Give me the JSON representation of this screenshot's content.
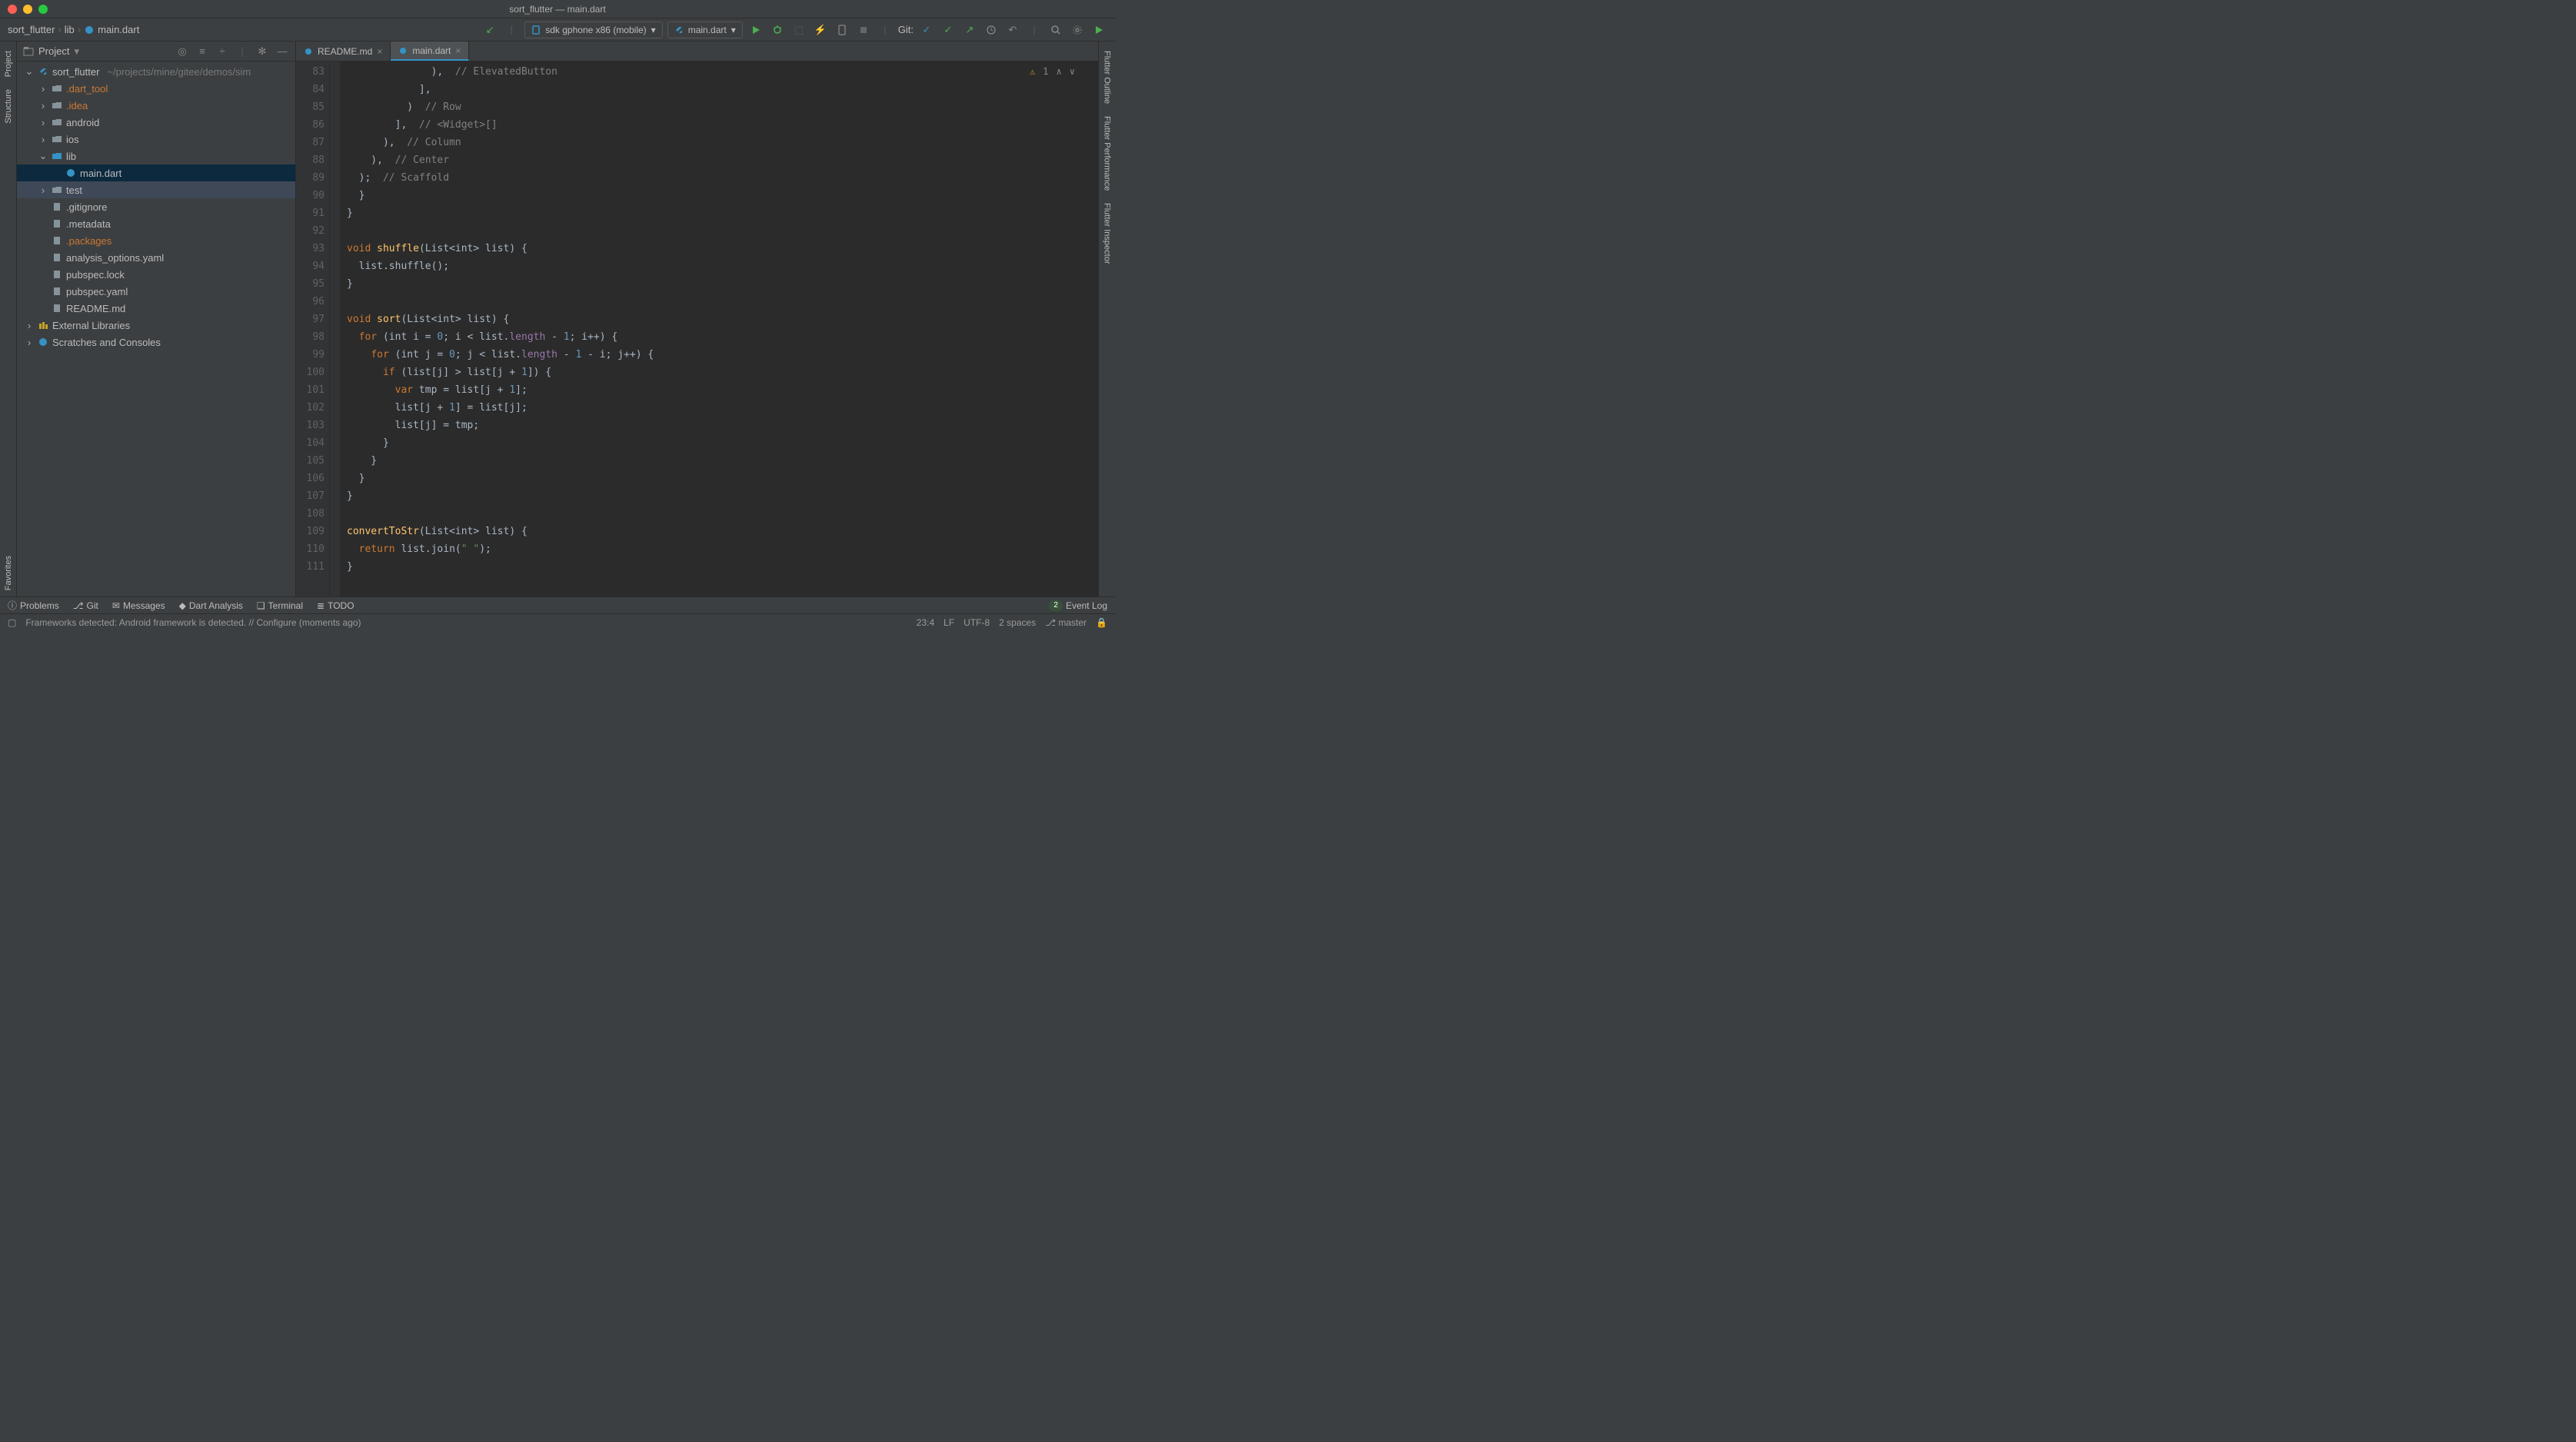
{
  "title": "sort_flutter — main.dart",
  "breadcrumb": [
    "sort_flutter",
    "lib",
    "main.dart"
  ],
  "toolbar": {
    "device": "sdk gphone x86 (mobile)",
    "config": "main.dart",
    "git_label": "Git:"
  },
  "project_panel": {
    "title": "Project"
  },
  "tree": {
    "root": {
      "name": "sort_flutter",
      "path": "~/projects/mine/gitee/demos/sim"
    },
    "items": [
      {
        "label": ".dart_tool",
        "orange": true,
        "arrow": ">",
        "indent": 1
      },
      {
        "label": ".idea",
        "orange": true,
        "arrow": ">",
        "indent": 1
      },
      {
        "label": "android",
        "arrow": ">",
        "indent": 1
      },
      {
        "label": "ios",
        "arrow": ">",
        "indent": 1
      },
      {
        "label": "lib",
        "arrow": "v",
        "indent": 1
      },
      {
        "label": "main.dart",
        "arrow": "",
        "indent": 2,
        "selected": true
      },
      {
        "label": "test",
        "arrow": ">",
        "indent": 1,
        "highlight": true
      },
      {
        "label": ".gitignore",
        "arrow": "",
        "indent": 1
      },
      {
        "label": ".metadata",
        "arrow": "",
        "indent": 1
      },
      {
        "label": ".packages",
        "orange": true,
        "arrow": "",
        "indent": 1
      },
      {
        "label": "analysis_options.yaml",
        "arrow": "",
        "indent": 1
      },
      {
        "label": "pubspec.lock",
        "arrow": "",
        "indent": 1
      },
      {
        "label": "pubspec.yaml",
        "arrow": "",
        "indent": 1
      },
      {
        "label": "README.md",
        "arrow": "",
        "indent": 1
      }
    ],
    "external": "External Libraries",
    "scratches": "Scratches and Consoles"
  },
  "tabs": [
    {
      "label": "README.md",
      "active": false
    },
    {
      "label": "main.dart",
      "active": true
    }
  ],
  "editor": {
    "warning_count": "1",
    "lines": [
      {
        "n": 83,
        "html": "              ),  <span class='com'>// ElevatedButton</span>"
      },
      {
        "n": 84,
        "html": "            ],"
      },
      {
        "n": 85,
        "html": "          )  <span class='com'>// Row</span>"
      },
      {
        "n": 86,
        "html": "        ],  <span class='com'>// &lt;Widget&gt;[]</span>"
      },
      {
        "n": 87,
        "html": "      ),  <span class='com'>// Column</span>"
      },
      {
        "n": 88,
        "html": "    ),  <span class='com'>// Center</span>"
      },
      {
        "n": 89,
        "html": "  );  <span class='com'>// Scaffold</span>"
      },
      {
        "n": 90,
        "html": "  }"
      },
      {
        "n": 91,
        "html": "}"
      },
      {
        "n": 92,
        "html": ""
      },
      {
        "n": 93,
        "html": "<span class='kw'>void</span> <span class='fn'>shuffle</span>(List&lt;int&gt; list) {"
      },
      {
        "n": 94,
        "html": "  list.shuffle();"
      },
      {
        "n": 95,
        "html": "}"
      },
      {
        "n": 96,
        "html": ""
      },
      {
        "n": 97,
        "html": "<span class='kw'>void</span> <span class='fn'>sort</span>(List&lt;int&gt; list) {"
      },
      {
        "n": 98,
        "html": "  <span class='kw'>for</span> (int i = <span class='num'>0</span>; i &lt; list.<span class='prop'>length</span> - <span class='num'>1</span>; i++) {"
      },
      {
        "n": 99,
        "html": "    <span class='kw'>for</span> (int j = <span class='num'>0</span>; j &lt; list.<span class='prop'>length</span> - <span class='num'>1</span> - i; j++) {"
      },
      {
        "n": 100,
        "html": "      <span class='kw'>if</span> (list[j] &gt; list[j + <span class='num'>1</span>]) {"
      },
      {
        "n": 101,
        "html": "        <span class='kw'>var</span> tmp = list[j + <span class='num'>1</span>];"
      },
      {
        "n": 102,
        "html": "        list[j + <span class='num'>1</span>] = list[j];"
      },
      {
        "n": 103,
        "html": "        list[j] = tmp;"
      },
      {
        "n": 104,
        "html": "      }"
      },
      {
        "n": 105,
        "html": "    }"
      },
      {
        "n": 106,
        "html": "  }"
      },
      {
        "n": 107,
        "html": "}"
      },
      {
        "n": 108,
        "html": ""
      },
      {
        "n": 109,
        "html": "<span class='fn'>convertToStr</span>(List&lt;int&gt; list) {"
      },
      {
        "n": 110,
        "html": "  <span class='kw'>return</span> list.join(<span class='str'>\" \"</span>);"
      },
      {
        "n": 111,
        "html": "}"
      }
    ]
  },
  "left_tools": [
    "Project",
    "Structure",
    "Favorites"
  ],
  "right_tools": [
    "Flutter Outline",
    "Flutter Performance",
    "Flutter Inspector"
  ],
  "bottom_tools": {
    "items": [
      "Problems",
      "Git",
      "Messages",
      "Dart Analysis",
      "Terminal",
      "TODO"
    ],
    "event_log": "Event Log",
    "event_count": "2"
  },
  "statusbar": {
    "msg": "Frameworks detected: Android framework is detected. // Configure (moments ago)",
    "pos": "23:4",
    "le": "LF",
    "enc": "UTF-8",
    "indent": "2 spaces",
    "branch": "master"
  }
}
